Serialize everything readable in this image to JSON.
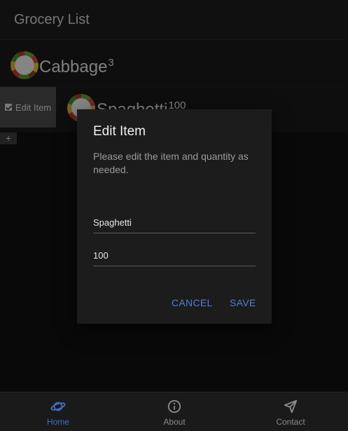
{
  "header": {
    "title": "Grocery List"
  },
  "list": {
    "items": [
      {
        "name": "Cabbage",
        "quantity": "3"
      },
      {
        "name": "Spaghetti",
        "quantity": "100"
      }
    ],
    "edit_action_label": "Edit Item",
    "add_label": "+"
  },
  "dialog": {
    "title": "Edit Item",
    "message": "Please edit the item and quantity as needed.",
    "name_value": "Spaghetti",
    "quantity_value": "100",
    "cancel_label": "CANCEL",
    "save_label": "SAVE"
  },
  "nav": {
    "items": [
      {
        "label": "Home",
        "icon": "planet-icon",
        "active": true
      },
      {
        "label": "About",
        "icon": "info-icon",
        "active": false
      },
      {
        "label": "Contact",
        "icon": "send-icon",
        "active": false
      }
    ]
  },
  "colors": {
    "accent": "#4e7fd6",
    "background": "#111111",
    "dialog": "#1c1c1c"
  }
}
